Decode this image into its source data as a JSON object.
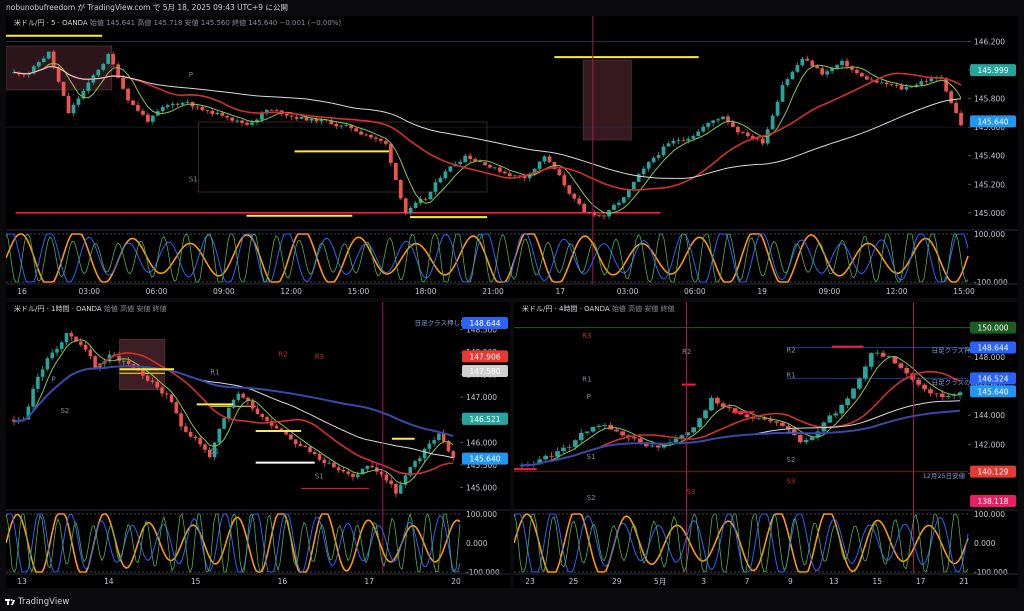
{
  "header": {
    "publish_line": "nobunobufreedom が TradingView.com で 5月 18, 2025 09:43 UTC+9 に公開"
  },
  "footer": {
    "brand": "TradingView"
  },
  "colors": {
    "up": "#26a69a",
    "down": "#ef5350",
    "bg": "#000000",
    "ma_red": "#d32f2f",
    "ma_white": "#d9d9d9",
    "ma_green": "#8bc34a",
    "osc_orange": "#ff9800",
    "osc_blue": "#2962ff",
    "osc_green": "#4caf50",
    "level_yellow": "#ffeb3b",
    "level_red": "#ff1744"
  },
  "chart_data": [
    {
      "id": "5m",
      "type": "line",
      "title": "米ドル/円 · 5 · OANDA",
      "ohlc_labels": [
        "始値",
        "145.641",
        "高値",
        "145.718",
        "安値",
        "145.560",
        "終値",
        "145.640",
        "−0.001 (−0.00%)"
      ],
      "y_ticks": [
        "146.200",
        "146.000",
        "145.800",
        "145.600",
        "145.400",
        "145.200",
        "145.000"
      ],
      "ylim": [
        144.88,
        146.28
      ],
      "x_ticks": [
        "16",
        "03:00",
        "06:00",
        "09:00",
        "12:00",
        "15:00",
        "18:00",
        "21:00",
        "17",
        "03:00",
        "06:00",
        "19",
        "09:00",
        "12:00",
        "15:00"
      ],
      "price_tags": [
        {
          "value": "145.999",
          "color": "#26a69a"
        },
        {
          "value": "145.640",
          "color": "#2196f3"
        }
      ],
      "zone_labels": [
        "P",
        "S1"
      ],
      "close_series": [
        145.98,
        146.12,
        145.7,
        145.9,
        146.1,
        145.8,
        145.65,
        145.75,
        145.78,
        145.7,
        145.68,
        145.62,
        145.72,
        145.69,
        145.66,
        145.64,
        145.6,
        145.55,
        145.48,
        145.0,
        145.1,
        145.3,
        145.4,
        145.35,
        145.28,
        145.25,
        145.4,
        145.2,
        145.0,
        144.98,
        145.1,
        145.3,
        145.45,
        145.52,
        145.6,
        145.68,
        145.55,
        145.5,
        145.9,
        146.08,
        145.98,
        146.05,
        145.95,
        145.9,
        145.87,
        145.92,
        145.95,
        145.62
      ],
      "oscillator": {
        "ylim": [
          -100,
          100
        ],
        "ticks": [
          "100.000",
          "-100.000"
        ]
      }
    },
    {
      "id": "1h",
      "type": "line",
      "title": "米ドル/円 · 1時間 · OANDA",
      "ohlc_labels": [
        "始値",
        "高値",
        "安値",
        "終値"
      ],
      "y_ticks": [
        "148.500",
        "148.000",
        "147.500",
        "147.000",
        "146.500",
        "146.000",
        "145.500",
        "145.000"
      ],
      "ylim": [
        144.5,
        148.8
      ],
      "x_ticks": [
        "13",
        "14",
        "15",
        "16",
        "17",
        "20"
      ],
      "price_tags": [
        {
          "value": "148.644",
          "color": "#2962ff"
        },
        {
          "value": "147.906",
          "color": "#e53935"
        },
        {
          "value": "147.580",
          "color": "#cfcfcf"
        },
        {
          "value": "146.524",
          "color": "#2962ff"
        },
        {
          "value": "146.521",
          "color": "#26a69a"
        },
        {
          "value": "145.640",
          "color": "#2196f3"
        }
      ],
      "zone_labels": [
        "R2",
        "R1",
        "P",
        "S1",
        "S2",
        "R3",
        "S1"
      ],
      "note": "日足クラス押し目",
      "close_series": [
        146.5,
        147.5,
        148.0,
        148.4,
        148.2,
        147.7,
        147.9,
        147.8,
        147.6,
        147.3,
        147.0,
        146.4,
        146.1,
        145.7,
        146.5,
        147.1,
        146.8,
        146.5,
        146.3,
        146.0,
        145.8,
        145.6,
        145.4,
        145.2,
        145.5,
        145.3,
        144.9,
        145.4,
        145.8,
        146.2,
        145.64
      ],
      "oscillator": {
        "ylim": [
          -100,
          100
        ],
        "ticks": [
          "100.000",
          "0.000",
          "-100.000"
        ]
      }
    },
    {
      "id": "4h",
      "type": "line",
      "title": "米ドル/円 · 4時間 · OANDA",
      "ohlc_labels": [
        "始値",
        "高値",
        "安値",
        "終値"
      ],
      "y_ticks": [
        "150.000",
        "148.000",
        "146.000",
        "144.000",
        "142.000",
        "140.000"
      ],
      "ylim": [
        137.5,
        150.8
      ],
      "x_ticks": [
        "23",
        "25",
        "29",
        "5月",
        "3",
        "7",
        "9",
        "13",
        "15",
        "17",
        "21"
      ],
      "price_tags": [
        {
          "value": "150.000",
          "color": "#1b5e20"
        },
        {
          "value": "148.644",
          "color": "#2962ff"
        },
        {
          "value": "146.524",
          "color": "#2962ff"
        },
        {
          "value": "145.640",
          "color": "#2196f3"
        },
        {
          "value": "140.129",
          "color": "#e53935"
        },
        {
          "value": "138.118",
          "color": "#e91e63"
        }
      ],
      "zone_labels": [
        "R3",
        "R2",
        "R1",
        "P",
        "S1",
        "S2",
        "S3",
        "R2",
        "R1",
        "S1",
        "S2",
        "S3"
      ],
      "notes": [
        "日足クラス押し目",
        "日足クラスの最近安値",
        "12月25日安値"
      ],
      "close_series": [
        140.5,
        141.2,
        142.0,
        143.0,
        143.5,
        142.5,
        142.0,
        141.8,
        142.3,
        143.0,
        145.2,
        144.5,
        144.0,
        143.6,
        143.2,
        142.3,
        143.0,
        144.2,
        145.8,
        148.3,
        147.9,
        146.9,
        145.9,
        145.3,
        145.64
      ],
      "oscillator": {
        "ylim": [
          -100,
          100
        ],
        "ticks": [
          "100.000",
          "0.000",
          "-100.000"
        ]
      }
    }
  ]
}
